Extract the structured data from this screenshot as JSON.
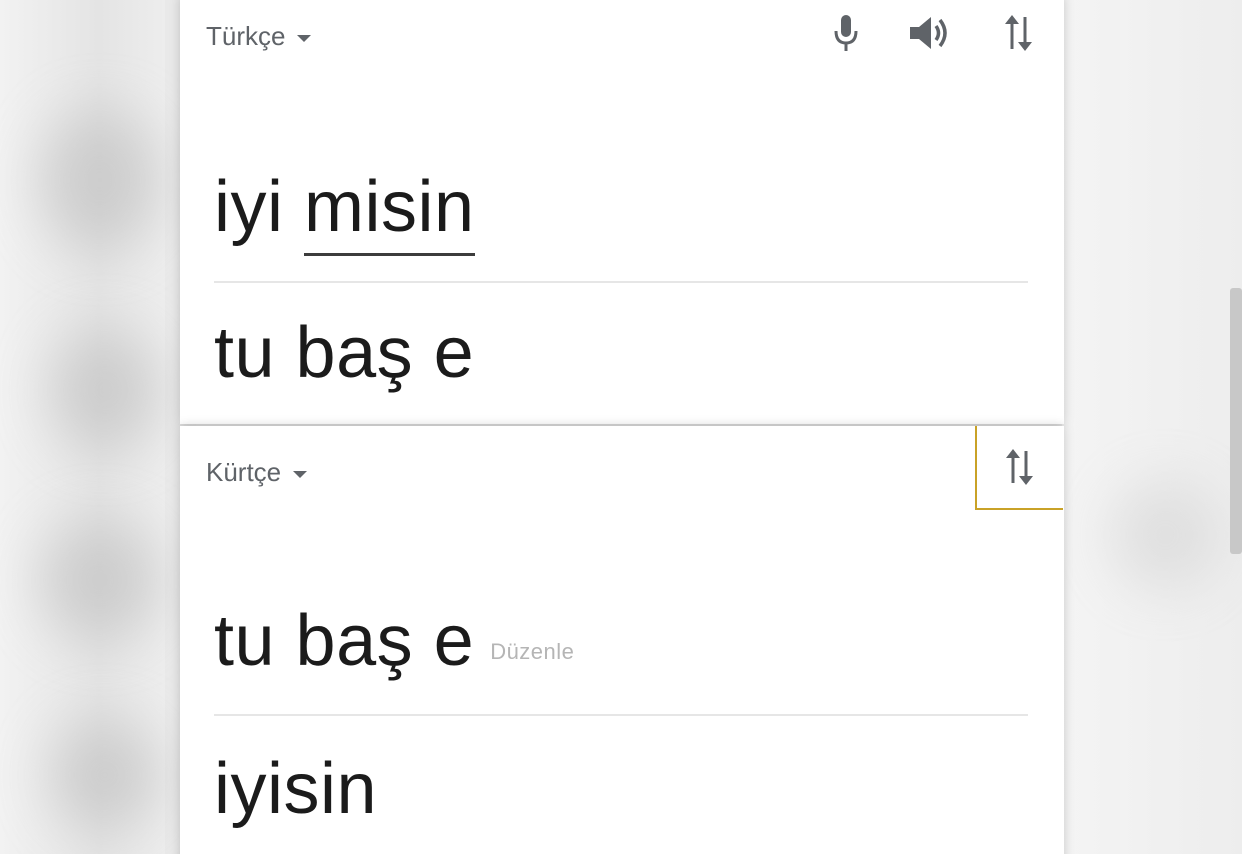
{
  "source_panel": {
    "language": "Türkçe",
    "input_text_plain": "iyi ",
    "input_text_flagged": "misin",
    "translation": "tu baş e",
    "icons": [
      "microphone-icon",
      "speaker-icon",
      "swap-icon"
    ]
  },
  "target_panel": {
    "language": "Kürtçe",
    "input_text": "tu baş e",
    "edit_label": "Düzenle",
    "translation": "iyisin",
    "icons": [
      "swap-icon"
    ]
  },
  "colors": {
    "text": "#1b1b1b",
    "secondary": "#5f6368",
    "highlight_border": "#c9a227",
    "divider": "#e6e6e6"
  }
}
